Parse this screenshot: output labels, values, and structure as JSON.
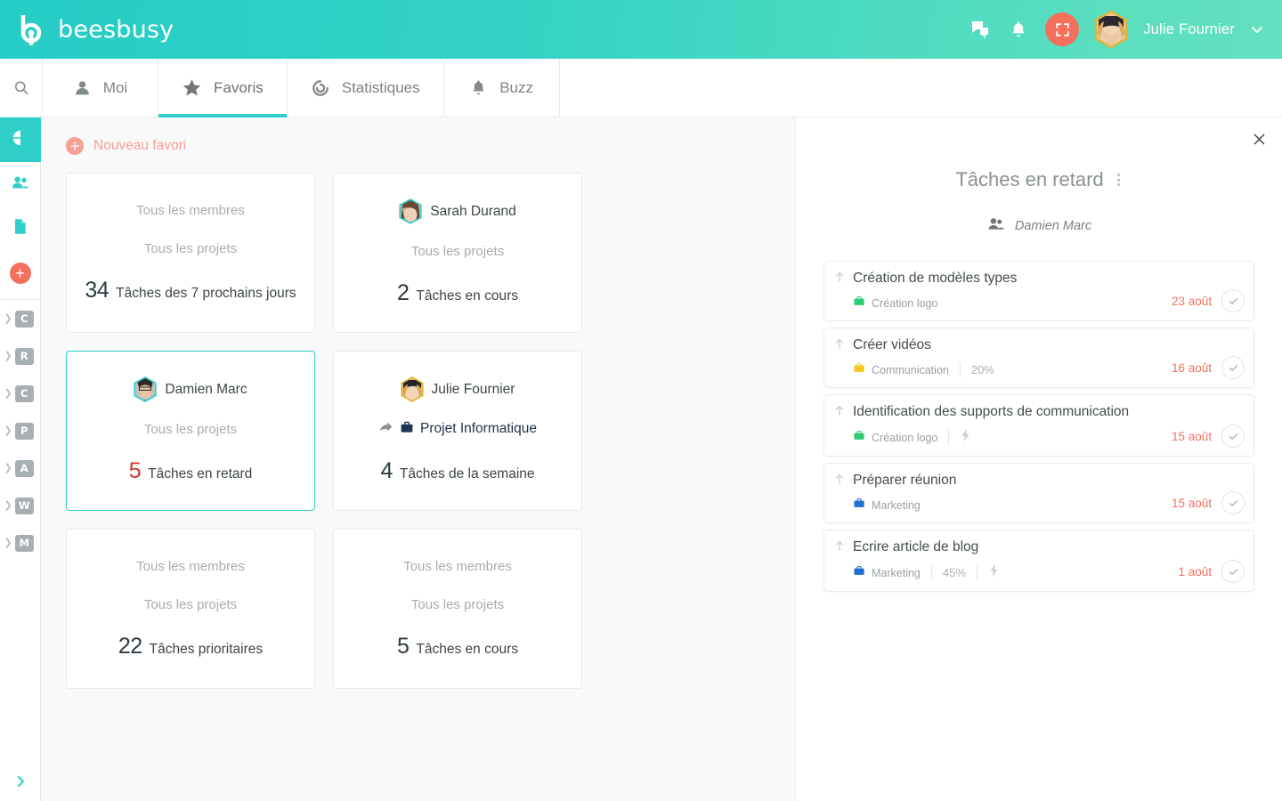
{
  "brand": {
    "name": "beesbusy",
    "logo_icon": "beesbusy-logo"
  },
  "header": {
    "help_icon": "help-chat-icon",
    "bell_icon": "bell-icon",
    "fullscreen_icon": "fullscreen-icon",
    "avatar_icon": "user-avatar",
    "username": "Julie Fournier",
    "caret_icon": "chevron-down-icon",
    "accent_teal": "#2ecfc8",
    "accent_coral": "#f4705c"
  },
  "nav": {
    "search_icon": "search-icon",
    "tabs": [
      {
        "label": "Moi",
        "icon": "person-icon",
        "active": false
      },
      {
        "label": "Favoris",
        "icon": "star-icon",
        "active": true
      },
      {
        "label": "Statistiques",
        "icon": "donut-chart-icon",
        "active": false
      },
      {
        "label": "Buzz",
        "icon": "bell-icon",
        "active": false
      }
    ]
  },
  "rail": {
    "top_items": [
      {
        "icon": "dashboard-pie-icon",
        "active": true
      },
      {
        "icon": "people-icon",
        "active": false
      },
      {
        "icon": "document-icon",
        "active": false
      },
      {
        "icon": "add-plus-icon",
        "active": false
      }
    ],
    "projects": [
      {
        "letter": "C"
      },
      {
        "letter": "R"
      },
      {
        "letter": "C"
      },
      {
        "letter": "P"
      },
      {
        "letter": "A"
      },
      {
        "letter": "W"
      },
      {
        "letter": "M"
      }
    ],
    "expand_icon": "chevron-right-icon"
  },
  "favorites": {
    "new_label": "Nouveau favori",
    "new_icon": "plus-circle-icon",
    "cards": [
      {
        "scope_member": "Tous les membres",
        "scope_project": "Tous les projets",
        "count": "34",
        "count_label": "Tâches des 7 prochains jours",
        "selected": false,
        "has_avatar": false,
        "late": false
      },
      {
        "scope_member": "Sarah Durand",
        "scope_project": "Tous les projets",
        "count": "2",
        "count_label": "Tâches en cours",
        "selected": false,
        "has_avatar": true,
        "late": false
      },
      {
        "scope_member": "Damien Marc",
        "scope_project": "Tous les projets",
        "count": "5",
        "count_label": "Tâches en retard",
        "selected": true,
        "has_avatar": true,
        "late": true
      },
      {
        "scope_member": "Julie Fournier",
        "scope_project": "Projet Informatique",
        "count": "4",
        "count_label": "Tâches de la semaine",
        "selected": false,
        "has_avatar": true,
        "late": false,
        "project_icons": [
          "share-arrow-icon",
          "briefcase-icon"
        ]
      },
      {
        "scope_member": "Tous les membres",
        "scope_project": "Tous les projets",
        "count": "22",
        "count_label": "Tâches prioritaires",
        "selected": false,
        "has_avatar": false,
        "late": false
      },
      {
        "scope_member": "Tous les membres",
        "scope_project": "Tous les projets",
        "count": "5",
        "count_label": "Tâches en cours",
        "selected": false,
        "has_avatar": false,
        "late": false
      }
    ]
  },
  "panel": {
    "close_icon": "close-icon",
    "title": "Tâches en retard",
    "menu_icon": "more-vertical-icon",
    "member_icon": "people-icon",
    "member": "Damien Marc",
    "tasks": [
      {
        "name": "Création de modèles types",
        "arrow_icon": "arrow-up-icon",
        "project": "Création logo",
        "project_color": "#2ecc71",
        "percent": "",
        "priority": false,
        "date": "23 août",
        "check_icon": "check-circle-icon"
      },
      {
        "name": "Créer vidéos",
        "arrow_icon": "arrow-up-icon",
        "project": "Communication",
        "project_color": "#f5c518",
        "percent": "20%",
        "priority": false,
        "date": "16 août",
        "check_icon": "check-circle-icon"
      },
      {
        "name": "Identification des supports de communication",
        "arrow_icon": "arrow-up-icon",
        "project": "Création logo",
        "project_color": "#2ecc71",
        "percent": "",
        "priority": true,
        "date": "15 août",
        "check_icon": "check-circle-icon"
      },
      {
        "name": "Préparer réunion",
        "arrow_icon": "arrow-up-icon",
        "project": "Marketing",
        "project_color": "#1f6fd0",
        "percent": "",
        "priority": false,
        "date": "15 août",
        "check_icon": "check-circle-icon"
      },
      {
        "name": "Ecrire article de blog",
        "arrow_icon": "arrow-up-icon",
        "project": "Marketing",
        "project_color": "#1f6fd0",
        "percent": "45%",
        "priority": true,
        "date": "1 août",
        "check_icon": "check-circle-icon"
      }
    ]
  }
}
